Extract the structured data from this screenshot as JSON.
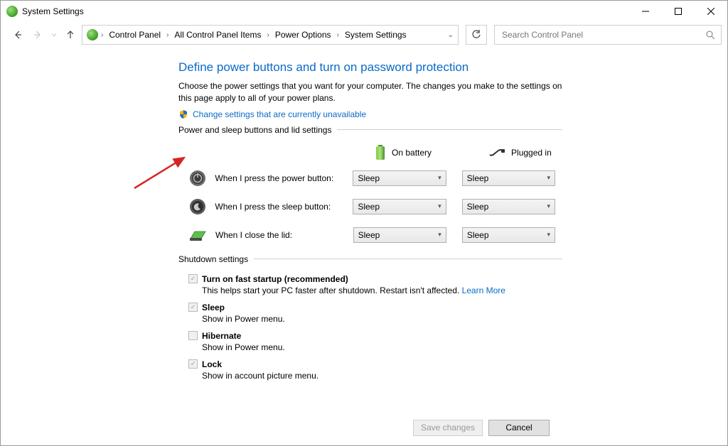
{
  "window": {
    "title": "System Settings"
  },
  "breadcrumbs": {
    "b0": "Control Panel",
    "b1": "All Control Panel Items",
    "b2": "Power Options",
    "b3": "System Settings"
  },
  "search": {
    "placeholder": "Search Control Panel"
  },
  "main": {
    "heading": "Define power buttons and turn on password protection",
    "description": "Choose the power settings that you want for your computer. The changes you make to the settings on this page apply to all of your power plans.",
    "change_link": "Change settings that are currently unavailable",
    "section1_label": "Power and sleep buttons and lid settings",
    "col_battery": "On battery",
    "col_plugged": "Plugged in",
    "rows": {
      "power": {
        "label": "When I press the power button:",
        "battery": "Sleep",
        "plugged": "Sleep"
      },
      "sleep": {
        "label": "When I press the sleep button:",
        "battery": "Sleep",
        "plugged": "Sleep"
      },
      "lid": {
        "label": "When I close the lid:",
        "battery": "Sleep",
        "plugged": "Sleep"
      }
    },
    "section2_label": "Shutdown settings",
    "shutdown": {
      "fast": {
        "label": "Turn on fast startup (recommended)",
        "desc": "This helps start your PC faster after shutdown. Restart isn't affected. ",
        "learn": "Learn More",
        "checked": true
      },
      "sleep": {
        "label": "Sleep",
        "desc": "Show in Power menu.",
        "checked": true
      },
      "hibernate": {
        "label": "Hibernate",
        "desc": "Show in Power menu.",
        "checked": false
      },
      "lock": {
        "label": "Lock",
        "desc": "Show in account picture menu.",
        "checked": true
      }
    }
  },
  "footer": {
    "save": "Save changes",
    "cancel": "Cancel"
  }
}
